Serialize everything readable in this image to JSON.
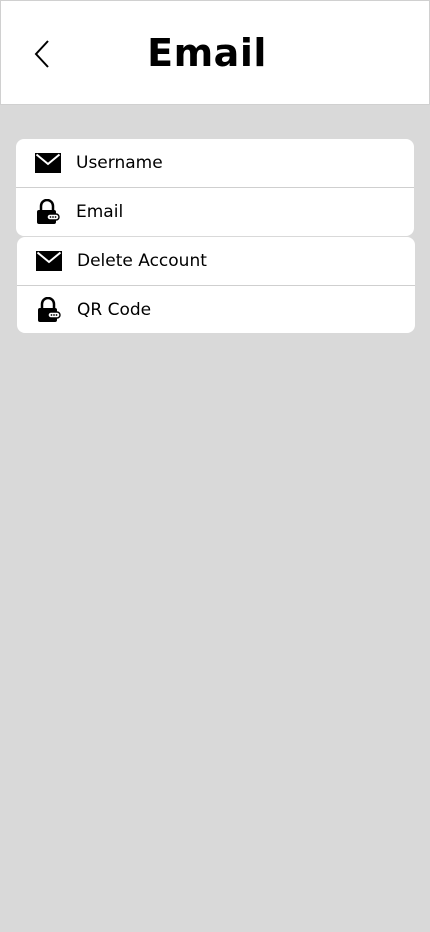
{
  "header": {
    "title": "Email",
    "back_icon": "chevron-left-icon"
  },
  "groups": [
    {
      "items": [
        {
          "label": "Username",
          "icon": "envelope-icon"
        },
        {
          "label": "Email",
          "icon": "lock-icon"
        }
      ]
    },
    {
      "items": [
        {
          "label": "Delete Account",
          "icon": "envelope-icon"
        },
        {
          "label": "QR Code",
          "icon": "lock-icon"
        }
      ]
    }
  ],
  "colors": {
    "background": "#d9d9d9",
    "card": "#ffffff",
    "text": "#000000",
    "divider": "#cfcfcf"
  }
}
